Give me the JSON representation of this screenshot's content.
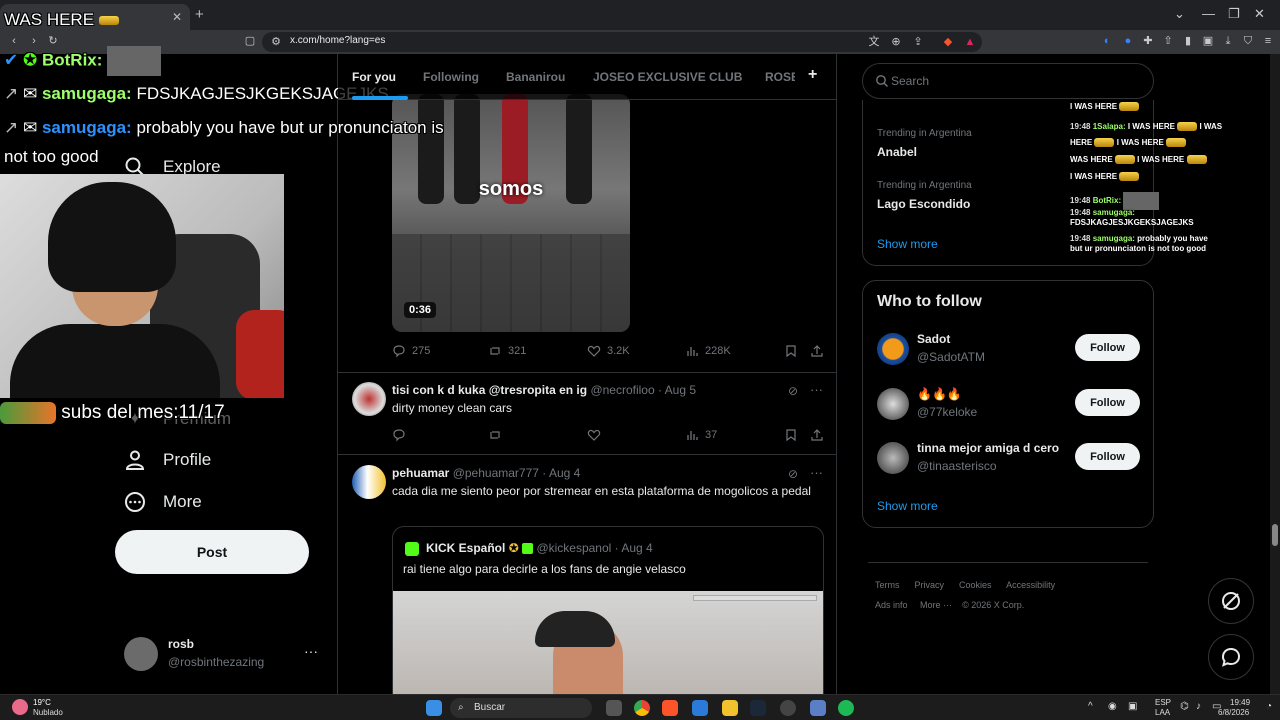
{
  "browser": {
    "url": "x.com/home?lang=es"
  },
  "nav": {
    "explore": "Explore",
    "premium": "Premium",
    "profile": "Profile",
    "more": "More",
    "post": "Post"
  },
  "account": {
    "name": "rosb",
    "handle": "@rosbinthezazing",
    "more": "···"
  },
  "tabs": [
    "For you",
    "Following",
    "Bananirou",
    "JOSEO EXCLUSIVE CLUB",
    "ROSB"
  ],
  "tweets": [
    {
      "video_caption": "somos",
      "video_duration": "0:36",
      "replies": "275",
      "reposts": "321",
      "likes": "3.2K",
      "views": "228K"
    },
    {
      "name": "tisi con k d kuka @tresropita en ig",
      "handle": "@necrofiloo",
      "date": "· Aug 5",
      "text": "dirty money clean cars",
      "views": "37"
    },
    {
      "name": "pehuamar",
      "handle": "@pehuamar777",
      "date": "· Aug 4",
      "text": "cada dia me siento peor por stremear en esta plataforma de mogolicos a pedal",
      "quote": {
        "name": "KICK Español",
        "handle": "@kickespanol",
        "date": "· Aug 4",
        "text": "rai tiene algo para decirle a los fans de angie velasco"
      }
    }
  ],
  "right": {
    "search_placeholder": "Search",
    "trends": [
      {
        "meta": "Trending in Argentina",
        "name": "Anabel"
      },
      {
        "meta": "Trending in Argentina",
        "name": "Lago Escondido"
      }
    ],
    "show_more": "Show more",
    "who_to_follow": "Who to follow",
    "suggestions": [
      {
        "name": "Sadot",
        "handle": "@SadotATM",
        "button": "Follow"
      },
      {
        "name": "🔥🔥🔥",
        "handle": "@77keloke",
        "button": "Follow"
      },
      {
        "name": "tinna mejor amiga d cero",
        "handle": "@tinaasterisco",
        "button": "Follow"
      }
    ],
    "footer": {
      "terms": "Terms",
      "privacy": "Privacy",
      "cookies": "Cookies",
      "accessibility": "Accessibility",
      "ads": "Ads info",
      "more": "More ···",
      "copyright": "© 2026 X Corp."
    }
  },
  "overlay": {
    "was_here": "WAS HERE",
    "botrix": "BotRix:",
    "user1": "samugaga:",
    "msg1": "FDSJKAGJESJKGEKSJAGEJKS",
    "user2": "samugaga:",
    "msg2": "probably you have but ur pronunciaton is",
    "msg2b": "not too good",
    "subs": "subs del mes:11/17"
  },
  "chat": {
    "line0": "I WAS HERE",
    "time": "19:48",
    "user": "1Salapa:",
    "line1": "I WAS HERE",
    "line1b": "I WAS",
    "line2": "HERE",
    "line2b": "I WAS HERE",
    "line3": "WAS HERE",
    "line3b": "I WAS HERE",
    "line4": "I WAS HERE",
    "botrix": "BotRix:",
    "samu1": "samugaga:",
    "samu1_msg": "FDSJKAGJESJKGEKSJAGEJKS",
    "samu2": "samugaga:",
    "samu2_msg": "probably you have",
    "samu2_msg2": "but ur pronunciaton is not too good"
  },
  "taskbar": {
    "temp": "19°C",
    "weather": "Nublado",
    "search": "Buscar",
    "lang1": "ESP",
    "lang2": "LAA",
    "time": "19:49",
    "date": "6/8/2026"
  },
  "colors": {
    "accent": "#1d9bf0",
    "background": "#000000",
    "border": "#2f3336",
    "muted": "#71767b"
  }
}
